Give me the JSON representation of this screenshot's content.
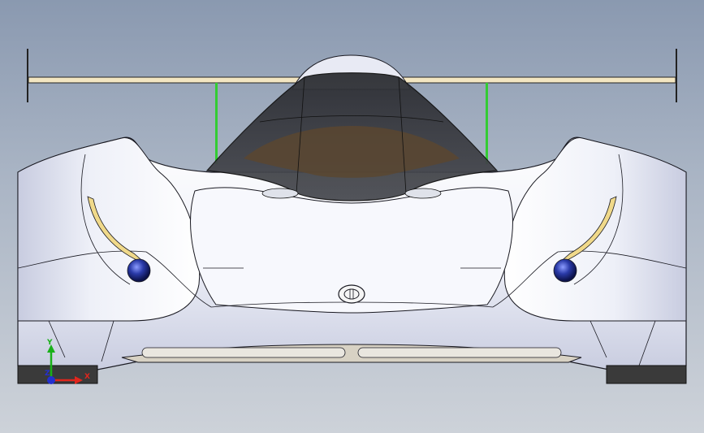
{
  "viewport": {
    "background_top": "#8a99b0",
    "background_bottom": "#cdd2d9"
  },
  "model": {
    "body_color": "#eef0f8",
    "edge_color": "#1a1a22",
    "canopy_color": "#3a3d44",
    "interior_color": "#5a4630",
    "wing_color": "#f3e6c2",
    "strut_color": "#33cc33",
    "headlight_color": "#2a3aa8",
    "tire_color": "#3a3a3a"
  },
  "triad": {
    "x_label": "X",
    "y_label": "Y",
    "z_label": "Z",
    "x_color": "#e0261d",
    "y_color": "#19b019",
    "z_color": "#2430d0"
  }
}
